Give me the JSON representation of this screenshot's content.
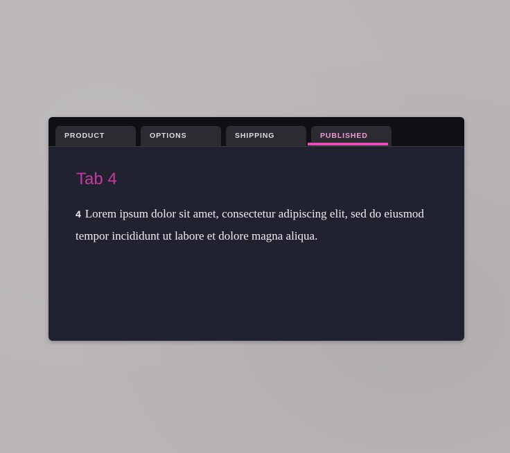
{
  "tabs": [
    {
      "label": "PRODUCT",
      "active": false
    },
    {
      "label": "OPTIONS",
      "active": false
    },
    {
      "label": "SHIPPING",
      "active": false
    },
    {
      "label": "PUBLISHED",
      "active": true
    }
  ],
  "panel": {
    "title": "Tab 4",
    "number": "4",
    "text": "Lorem ipsum dolor sit amet, consectetur adipiscing elit, sed do eiusmod tempor incididunt ut labore et dolore magna aliqua."
  },
  "colors": {
    "background": "#bab6b8",
    "tab_bar": "#101014",
    "tab": "#2b2b31",
    "panel": "#202230",
    "accent": "#e74fb5",
    "title": "#c63aa0",
    "active_tab_text": "#f29bd6"
  }
}
